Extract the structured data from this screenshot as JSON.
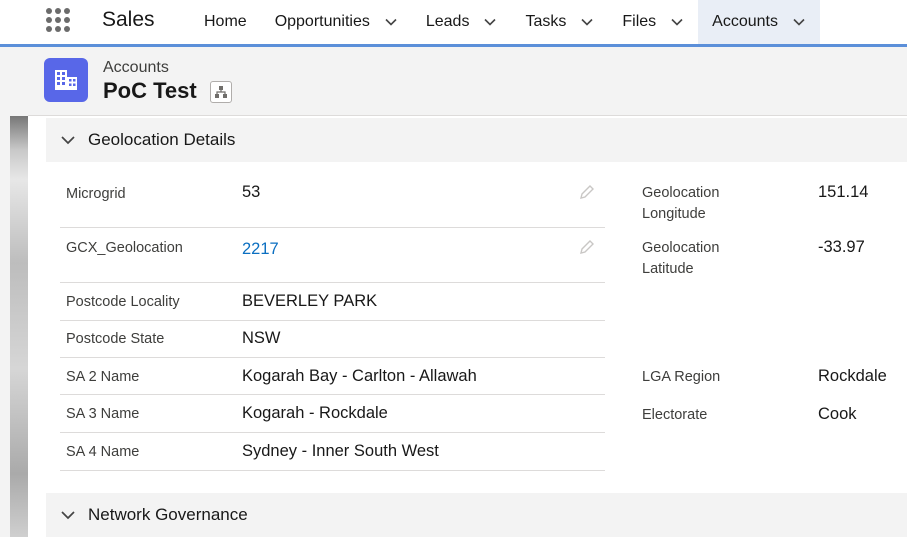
{
  "nav": {
    "app_name": "Sales",
    "items": [
      {
        "label": "Home",
        "has_menu": false
      },
      {
        "label": "Opportunities",
        "has_menu": true
      },
      {
        "label": "Leads",
        "has_menu": true
      },
      {
        "label": "Tasks",
        "has_menu": true
      },
      {
        "label": "Files",
        "has_menu": true
      },
      {
        "label": "Accounts",
        "has_menu": true,
        "active": true
      }
    ]
  },
  "header": {
    "object_label": "Accounts",
    "record_name": "PoC Test",
    "icon": "account-building-icon",
    "icon_color": "#5867e8"
  },
  "sections": [
    {
      "title": "Geolocation Details",
      "expanded": true
    },
    {
      "title": "Network Governance",
      "expanded": false
    }
  ],
  "geolocation_left": [
    {
      "label": "Microgrid",
      "value": "53",
      "editable": true
    },
    {
      "label": "GCX_Geolocation",
      "value": "2217",
      "editable": true,
      "link": true
    },
    {
      "label": "Postcode Locality",
      "value": "BEVERLEY PARK"
    },
    {
      "label": "Postcode State",
      "value": "NSW"
    },
    {
      "label": "SA 2 Name",
      "value": "Kogarah Bay - Carlton - Allawah"
    },
    {
      "label": "SA 3 Name",
      "value": "Kogarah - Rockdale"
    },
    {
      "label": "SA 4 Name",
      "value": "Sydney - Inner South West"
    }
  ],
  "geolocation_right": [
    {
      "label": "Geolocation Longitude",
      "value": "151.14"
    },
    {
      "label": "Geolocation Latitude",
      "value": "-33.97"
    },
    {
      "label": "LGA Region",
      "value": "Rockdale"
    },
    {
      "label": "Electorate",
      "value": "Cook"
    }
  ],
  "colors": {
    "nav_accent": "#5b8fd9",
    "link": "#0b6fc1",
    "active_tab_bg": "#e9eef6"
  }
}
